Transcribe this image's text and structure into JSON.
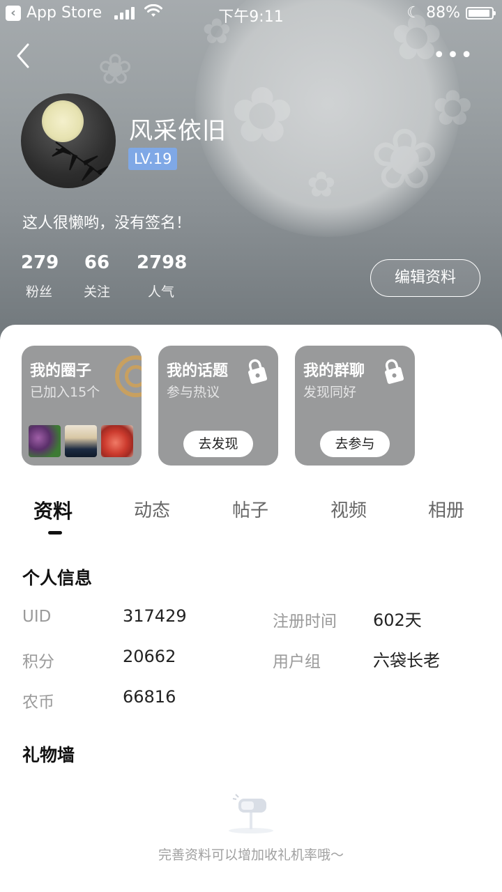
{
  "status_bar": {
    "back_app": "App Store",
    "time": "下午9:11",
    "battery": "88%"
  },
  "profile": {
    "name": "风采依旧",
    "level": "LV.19",
    "signature": "这人很懒哟，没有签名！",
    "stats": [
      {
        "value": "279",
        "label": "粉丝"
      },
      {
        "value": "66",
        "label": "关注"
      },
      {
        "value": "2798",
        "label": "人气"
      }
    ],
    "edit_button": "编辑资料"
  },
  "tiles": [
    {
      "title": "我的圈子",
      "subtitle": "已加入15个"
    },
    {
      "title": "我的话题",
      "subtitle": "参与热议",
      "button": "去发现"
    },
    {
      "title": "我的群聊",
      "subtitle": "发现同好",
      "button": "去参与"
    }
  ],
  "tabs": [
    "资料",
    "动态",
    "帖子",
    "视频",
    "相册"
  ],
  "personal_info": {
    "title": "个人信息",
    "rows": [
      {
        "label": "UID",
        "value": "317429"
      },
      {
        "label": "注册时间",
        "value": "602天"
      },
      {
        "label": "积分",
        "value": "20662"
      },
      {
        "label": "用户组",
        "value": "六袋长老"
      },
      {
        "label": "农币",
        "value": "66816"
      }
    ]
  },
  "gift_wall": {
    "title": "礼物墙",
    "empty_tip": "完善资料可以增加收礼机率哦～"
  },
  "colors": {
    "level_badge": "#7fa8e6",
    "tile_bg": "#999a9b"
  }
}
